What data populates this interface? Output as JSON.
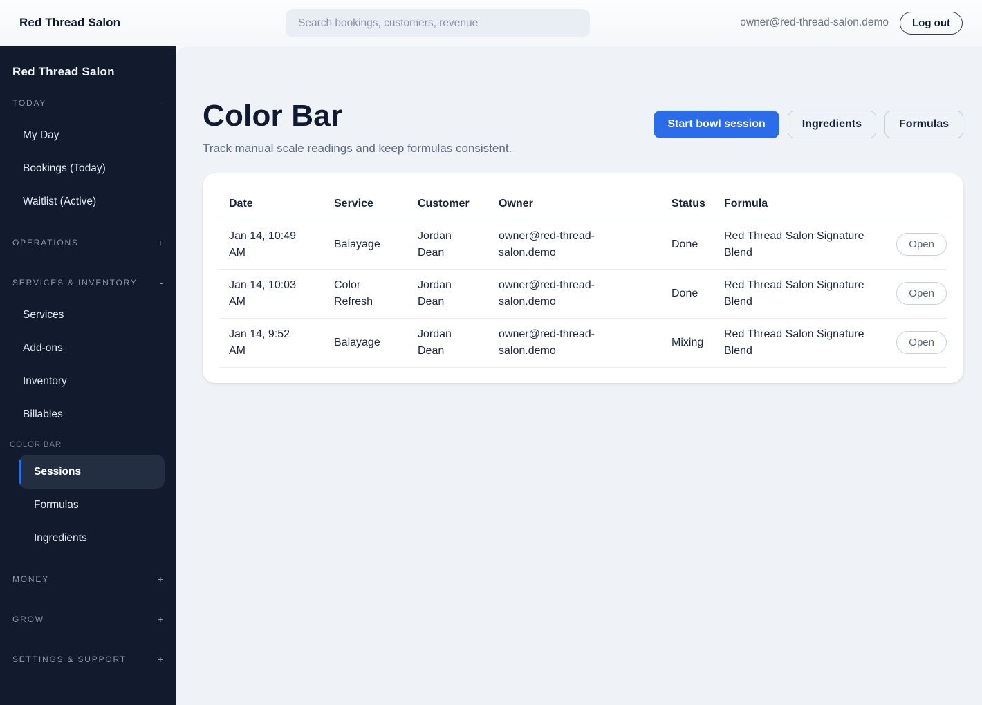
{
  "colors": {
    "accent_blue": "#2b6ceb",
    "sidebar_bg": "#111b2d",
    "main_bg": "#eff2f7",
    "card_bg": "#ffffff"
  },
  "header": {
    "brand": "Red Thread Salon",
    "search_placeholder": "Search bookings, customers, revenue",
    "search_value": "",
    "user_email": "owner@red-thread-salon.demo",
    "logout_label": "Log out"
  },
  "sidebar": {
    "title": "Red Thread Salon",
    "sections": [
      {
        "label": "TODAY",
        "toggle": "-",
        "items": [
          "My Day",
          "Bookings (Today)",
          "Waitlist (Active)"
        ]
      },
      {
        "label": "OPERATIONS",
        "toggle": "+",
        "items": []
      },
      {
        "label": "SERVICES & INVENTORY",
        "toggle": "-",
        "items": [
          "Services",
          "Add-ons",
          "Inventory",
          "Billables"
        ],
        "subgroup": {
          "label": "COLOR BAR",
          "items": [
            "Sessions",
            "Formulas",
            "Ingredients"
          ],
          "active_item": "Sessions"
        }
      },
      {
        "label": "MONEY",
        "toggle": "+",
        "items": []
      },
      {
        "label": "GROW",
        "toggle": "+",
        "items": []
      },
      {
        "label": "SETTINGS & SUPPORT",
        "toggle": "+",
        "items": []
      }
    ]
  },
  "page": {
    "title": "Color Bar",
    "subtitle": "Track manual scale readings and keep formulas consistent.",
    "actions": {
      "primary": "Start bowl session",
      "secondary": [
        "Ingredients",
        "Formulas"
      ]
    }
  },
  "sessions_table": {
    "columns": [
      "Date",
      "Service",
      "Customer",
      "Owner",
      "Status",
      "Formula"
    ],
    "open_label": "Open",
    "rows": [
      {
        "date": "Jan 14, 10:49 AM",
        "service": "Balayage",
        "customer": "Jordan Dean",
        "owner": "owner@red-thread-salon.demo",
        "status": "Done",
        "formula": "Red Thread Salon Signature Blend"
      },
      {
        "date": "Jan 14, 10:03 AM",
        "service": "Color Refresh",
        "customer": "Jordan Dean",
        "owner": "owner@red-thread-salon.demo",
        "status": "Done",
        "formula": "Red Thread Salon Signature Blend"
      },
      {
        "date": "Jan 14, 9:52 AM",
        "service": "Balayage",
        "customer": "Jordan Dean",
        "owner": "owner@red-thread-salon.demo",
        "status": "Mixing",
        "formula": "Red Thread Salon Signature Blend"
      }
    ]
  }
}
